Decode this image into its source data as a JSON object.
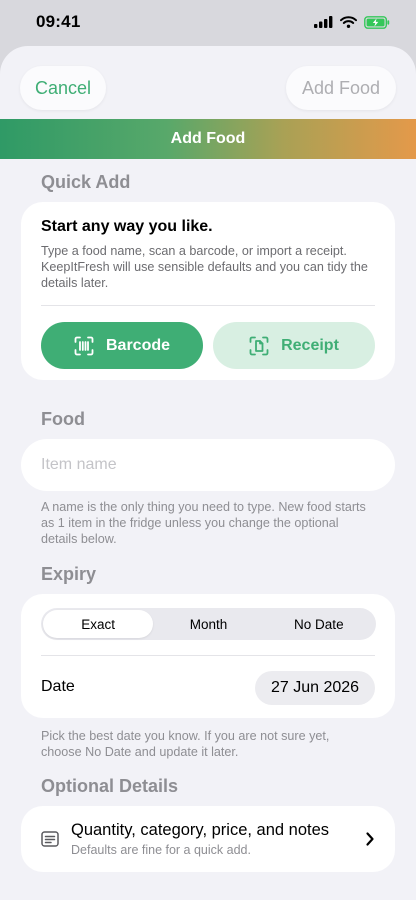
{
  "status_bar": {
    "time": "09:41"
  },
  "nav": {
    "cancel_label": "Cancel",
    "add_label": "Add Food"
  },
  "banner": {
    "title": "Add Food"
  },
  "quick_add": {
    "section_title": "Quick Add",
    "heading": "Start any way you like.",
    "description": "Type a food name, scan a barcode, or import a receipt. KeepItFresh will use sensible defaults and you can tidy the details later.",
    "barcode_label": "Barcode",
    "receipt_label": "Receipt"
  },
  "food": {
    "section_title": "Food",
    "name_value": "",
    "name_placeholder": "Item name",
    "helper": "A name is the only thing you need to type. New food starts as 1 item in the fridge unless you change the optional details below."
  },
  "expiry": {
    "section_title": "Expiry",
    "modes": [
      "Exact",
      "Month",
      "No Date"
    ],
    "selected_mode": "Exact",
    "date_label": "Date",
    "date_value": "27 Jun 2026",
    "helper": "Pick the best date you know. If you are not sure yet, choose No Date and update it later."
  },
  "optional": {
    "section_title": "Optional Details",
    "title": "Quantity, category, price, and notes",
    "subtitle": "Defaults are fine for a quick add."
  },
  "colors": {
    "accent": "#3fae75",
    "accent_soft": "#d8efe2",
    "gradient_start": "#2f9a66",
    "gradient_end": "#e4994a",
    "background": "#f2f2f7"
  },
  "icons": {
    "barcode": "barcode-scan-icon",
    "receipt": "receipt-scan-icon",
    "details": "notes-list-icon",
    "chevron": "chevron-right-icon"
  }
}
